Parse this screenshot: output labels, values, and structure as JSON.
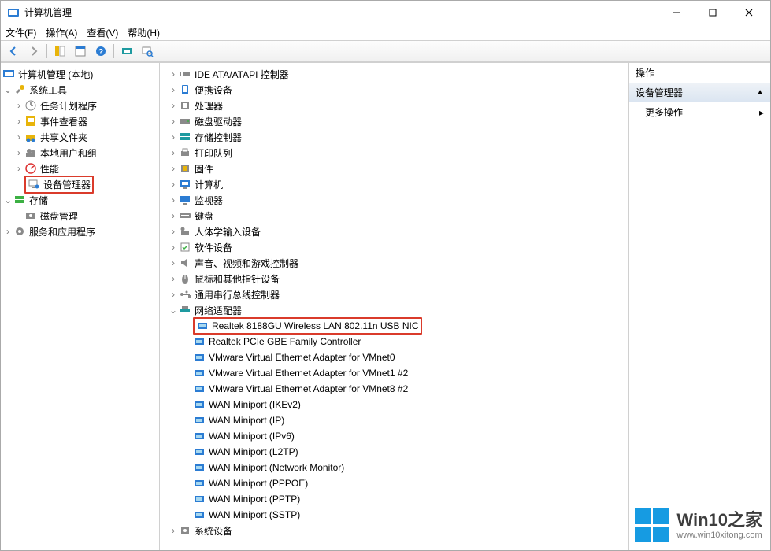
{
  "window": {
    "title": "计算机管理"
  },
  "menus": {
    "file": "文件(F)",
    "action": "操作(A)",
    "view": "查看(V)",
    "help": "帮助(H)"
  },
  "toolbar_icons": [
    "back",
    "forward",
    "up",
    "folder-prop",
    "grid",
    "help",
    "refresh",
    "divider",
    "devmgr-scan",
    "devmgr-view"
  ],
  "left_tree": {
    "root": "计算机管理 (本地)",
    "system_tools": "系统工具",
    "task_scheduler": "任务计划程序",
    "event_viewer": "事件查看器",
    "shared_folders": "共享文件夹",
    "local_users": "本地用户和组",
    "performance": "性能",
    "device_manager": "设备管理器",
    "storage": "存储",
    "disk_management": "磁盘管理",
    "services_apps": "服务和应用程序"
  },
  "device_tree": {
    "categories": [
      {
        "label": "IDE ATA/ATAPI 控制器",
        "icon": "ide"
      },
      {
        "label": "便携设备",
        "icon": "portable"
      },
      {
        "label": "处理器",
        "icon": "cpu"
      },
      {
        "label": "磁盘驱动器",
        "icon": "disk"
      },
      {
        "label": "存储控制器",
        "icon": "storage"
      },
      {
        "label": "打印队列",
        "icon": "printer"
      },
      {
        "label": "固件",
        "icon": "firmware"
      },
      {
        "label": "计算机",
        "icon": "computer"
      },
      {
        "label": "监视器",
        "icon": "monitor"
      },
      {
        "label": "键盘",
        "icon": "keyboard"
      },
      {
        "label": "人体学输入设备",
        "icon": "hid"
      },
      {
        "label": "软件设备",
        "icon": "software"
      },
      {
        "label": "声音、视频和游戏控制器",
        "icon": "sound"
      },
      {
        "label": "鼠标和其他指针设备",
        "icon": "mouse"
      },
      {
        "label": "通用串行总线控制器",
        "icon": "usb"
      }
    ],
    "net_category": "网络适配器",
    "net_adapters": [
      "Realtek 8188GU Wireless LAN 802.11n USB NIC",
      "Realtek PCIe GBE Family Controller",
      "VMware Virtual Ethernet Adapter for VMnet0",
      "VMware Virtual Ethernet Adapter for VMnet1 #2",
      "VMware Virtual Ethernet Adapter for VMnet8 #2",
      "WAN Miniport (IKEv2)",
      "WAN Miniport (IP)",
      "WAN Miniport (IPv6)",
      "WAN Miniport (L2TP)",
      "WAN Miniport (Network Monitor)",
      "WAN Miniport (PPPOE)",
      "WAN Miniport (PPTP)",
      "WAN Miniport (SSTP)"
    ],
    "system_devices": "系统设备"
  },
  "actions_panel": {
    "header": "操作",
    "subheader": "设备管理器",
    "more": "更多操作"
  },
  "watermark": {
    "brand": "Win10之家",
    "url": "www.win10xitong.com"
  },
  "highlight": {
    "left_item": "device_manager",
    "net_adapter_index": 0
  }
}
